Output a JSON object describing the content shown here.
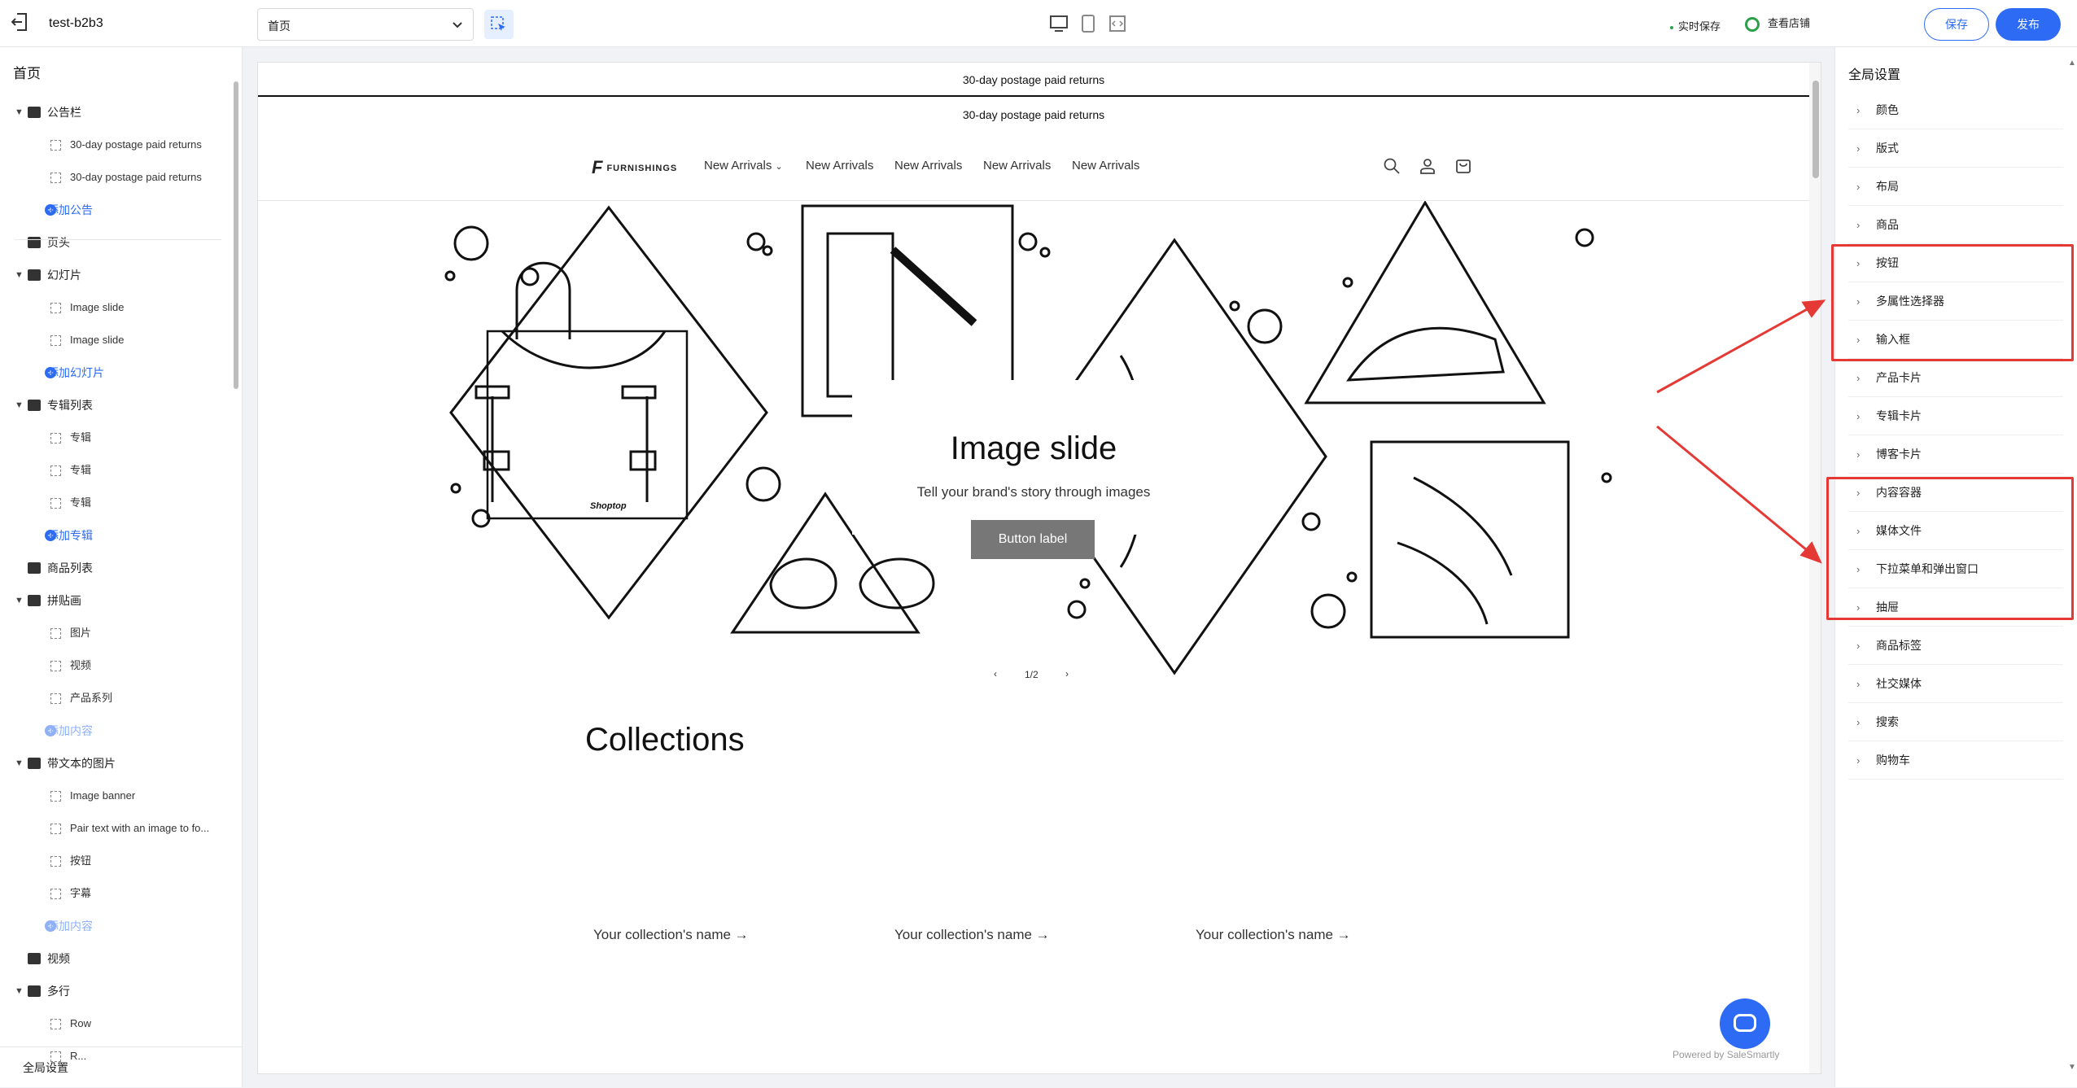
{
  "topbar": {
    "store_name": "test-b2b3",
    "page_select": "首页",
    "save_status": "实时保存",
    "view_store": "查看店铺",
    "save_label": "保存",
    "publish_label": "发布"
  },
  "sidebar": {
    "title": "首页",
    "items": [
      {
        "type": "group",
        "label": "公告栏",
        "icon": "announcement-icon"
      },
      {
        "type": "child",
        "label": "30-day postage paid returns"
      },
      {
        "type": "child",
        "label": "30-day postage paid returns"
      },
      {
        "type": "add",
        "label": "添加公告"
      },
      {
        "type": "section",
        "label": "页头",
        "icon": "header-icon"
      },
      {
        "type": "group",
        "label": "幻灯片",
        "icon": "slideshow-icon"
      },
      {
        "type": "child",
        "label": "Image slide"
      },
      {
        "type": "child",
        "label": "Image slide"
      },
      {
        "type": "add",
        "label": "添加幻灯片"
      },
      {
        "type": "group",
        "label": "专辑列表",
        "icon": "collection-list-icon"
      },
      {
        "type": "child",
        "label": "专辑"
      },
      {
        "type": "child",
        "label": "专辑"
      },
      {
        "type": "child",
        "label": "专辑"
      },
      {
        "type": "add",
        "label": "添加专辑"
      },
      {
        "type": "section",
        "label": "商品列表",
        "icon": "product-list-icon"
      },
      {
        "type": "group",
        "label": "拼贴画",
        "icon": "collage-icon"
      },
      {
        "type": "child",
        "label": "图片"
      },
      {
        "type": "child",
        "label": "视频"
      },
      {
        "type": "child",
        "label": "产品系列"
      },
      {
        "type": "adddim",
        "label": "添加内容"
      },
      {
        "type": "group",
        "label": "带文本的图片",
        "icon": "image-text-icon"
      },
      {
        "type": "child",
        "label": "Image banner"
      },
      {
        "type": "child",
        "label": "Pair text with an image to fo..."
      },
      {
        "type": "child",
        "label": "按钮"
      },
      {
        "type": "child",
        "label": "字幕"
      },
      {
        "type": "adddim",
        "label": "添加内容"
      },
      {
        "type": "section",
        "label": "视频",
        "icon": "video-icon"
      },
      {
        "type": "group",
        "label": "多行",
        "icon": "multirow-icon"
      },
      {
        "type": "child",
        "label": "Row"
      },
      {
        "type": "child",
        "label": "R..."
      }
    ],
    "footer": "全局设置"
  },
  "preview": {
    "announcement_1": "30-day postage paid returns",
    "announcement_2": "30-day postage paid returns",
    "logo_text": "FURNISHINGS",
    "nav": [
      "New Arrivals",
      "New Arrivals",
      "New Arrivals",
      "New Arrivals",
      "New Arrivals"
    ],
    "slide_title": "Image slide",
    "slide_subtitle": "Tell your brand's story through images",
    "slide_button": "Button label",
    "bag_brand": "Shoptop",
    "pager": "1/2",
    "collections_title": "Collections",
    "collections": [
      "Your collection's name →",
      "Your collection's name →",
      "Your collection's name →"
    ],
    "powered_by": "Powered by SaleSmartly"
  },
  "right_panel": {
    "title": "全局设置",
    "items": [
      "颜色",
      "版式",
      "布局",
      "商品",
      "按钮",
      "多属性选择器",
      "输入框",
      "产品卡片",
      "专辑卡片",
      "博客卡片",
      "内容容器",
      "媒体文件",
      "下拉菜单和弹出窗口",
      "抽屉",
      "商品标签",
      "社交媒体",
      "搜索",
      "购物车"
    ]
  },
  "colors": {
    "accent": "#2d6bf4",
    "highlight": "#e53935",
    "ok": "#2aa148"
  }
}
